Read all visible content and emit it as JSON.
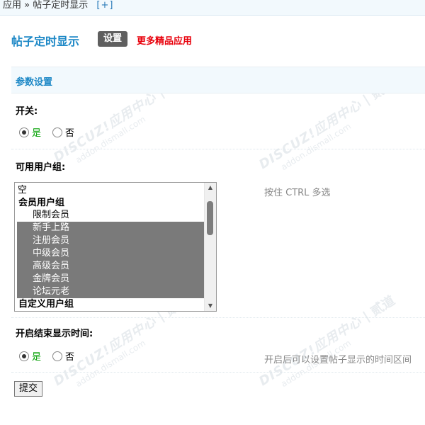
{
  "breadcrumb": {
    "app": "应用",
    "sep": "»",
    "current": "帖子定时显示",
    "add": "[+]"
  },
  "header": {
    "title": "帖子定时显示",
    "tab_settings": "设置",
    "more_apps": "更多精品应用"
  },
  "section": {
    "title": "参数设置"
  },
  "switch_field": {
    "label": "开关:",
    "yes": "是",
    "no": "否",
    "selected": "是"
  },
  "groups_field": {
    "label": "可用用户组:",
    "hint": "按住 CTRL 多选",
    "options": [
      {
        "text": "空",
        "type": "option",
        "selected": false
      },
      {
        "text": "会员用户组",
        "type": "group"
      },
      {
        "text": "限制会员",
        "type": "option",
        "selected": false
      },
      {
        "text": "新手上路",
        "type": "option",
        "selected": true
      },
      {
        "text": "注册会员",
        "type": "option",
        "selected": true
      },
      {
        "text": "中级会员",
        "type": "option",
        "selected": true
      },
      {
        "text": "高级会员",
        "type": "option",
        "selected": true
      },
      {
        "text": "金牌会员",
        "type": "option",
        "selected": true
      },
      {
        "text": "论坛元老",
        "type": "option",
        "selected": true
      },
      {
        "text": "自定义用户组",
        "type": "group"
      }
    ]
  },
  "time_field": {
    "label": "开启结束显示时间:",
    "yes": "是",
    "no": "否",
    "selected": "是",
    "hint": "开启后可以设置帖子显示的时间区间"
  },
  "submit_label": "提交",
  "watermark": {
    "brand": "DISCUZ!应用中心",
    "mark": "贰道",
    "domain": "addon.dismall.com"
  },
  "colors": {
    "title_blue": "#1d88c6",
    "more_red": "#e8000b",
    "yes_green": "#00a000",
    "selected_gray": "#7a7a7a",
    "section_bg": "#f2f9fd"
  }
}
